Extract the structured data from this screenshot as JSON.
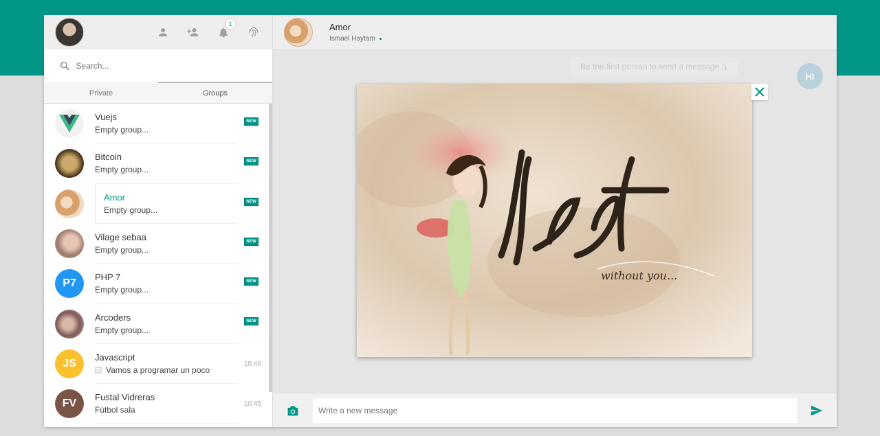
{
  "sidebar": {
    "search_placeholder": "Search...",
    "notification_count": "1",
    "tabs": [
      {
        "label": "Private"
      },
      {
        "label": "Groups"
      }
    ],
    "items": [
      {
        "name": "Vuejs",
        "sub": "Empty group...",
        "tag": "NEW"
      },
      {
        "name": "Bitcoin",
        "sub": "Empty group...",
        "tag": "NEW"
      },
      {
        "name": "Amor",
        "sub": "Empty group...",
        "tag": "NEW"
      },
      {
        "name": "Vilage sebaa",
        "sub": "Empty group...",
        "tag": "NEW"
      },
      {
        "name": "PHP 7",
        "initials": "P7",
        "sub": "Empty group...",
        "tag": "NEW"
      },
      {
        "name": "Arcoders",
        "sub": "Empty group...",
        "tag": "NEW"
      },
      {
        "name": "Javascript",
        "initials": "JS",
        "sub": "Vamos a programar un poco",
        "time": "10:46"
      },
      {
        "name": "Fustal Vidreras",
        "initials": "FV",
        "sub": "Fútbol sala",
        "time": "10:45"
      }
    ]
  },
  "chat": {
    "name": "Amor",
    "member": "Ismael Haytam",
    "hint": "Be the first person to send a message :)",
    "hi_initials": "HI",
    "preview_text_main": "lost",
    "preview_text_sub": "without you...",
    "composer_placeholder": "Write a new message"
  },
  "colors": {
    "accent": "#009688",
    "php": "#2196f3",
    "js": "#fbc02d",
    "fv": "#795548"
  }
}
